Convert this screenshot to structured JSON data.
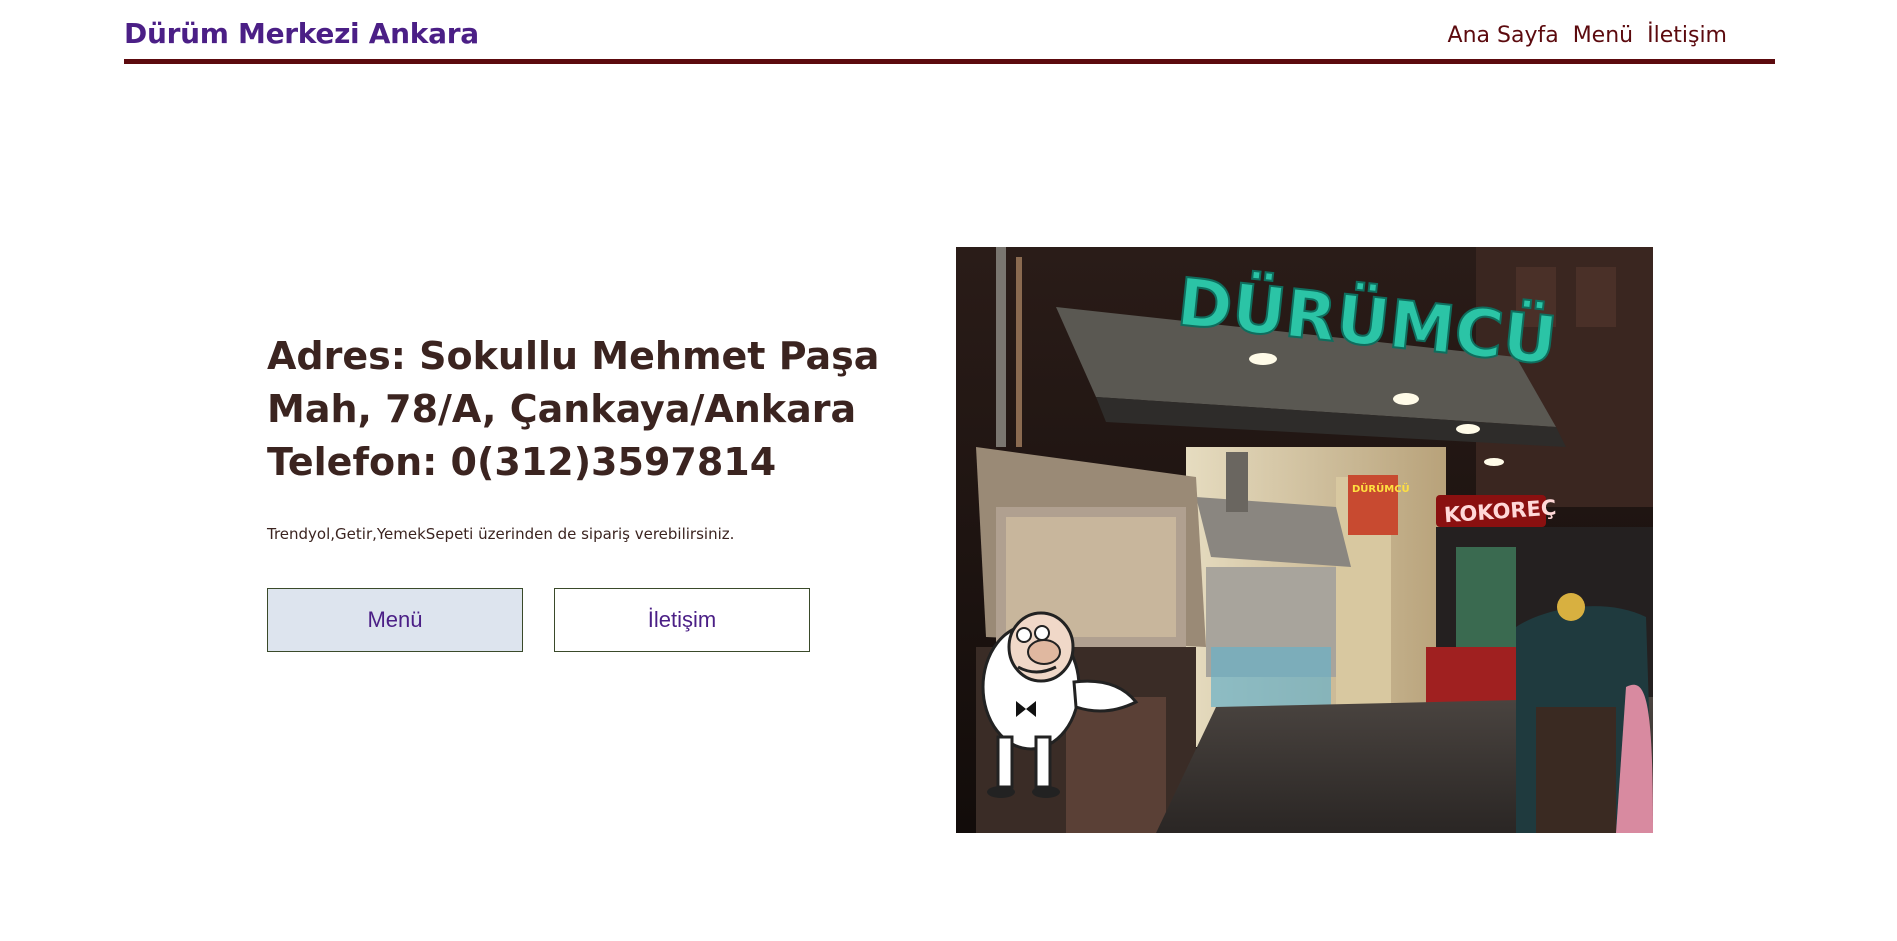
{
  "header": {
    "brand": "Dürüm Merkezi Ankara",
    "nav": [
      "Ana Sayfa",
      "Menü",
      "İletişim"
    ]
  },
  "info": {
    "address_lines": [
      "Adres: Sokullu Mehmet Paşa",
      "Mah, 78/A, Çankaya/Ankara",
      "Telefon: 0(312)3597814"
    ],
    "note": "Trendyol,Getir,YemekSepeti üzerinden de sipariş verebilirsiniz."
  },
  "buttons": {
    "menu": "Menü",
    "contact": "İletişim"
  },
  "photo": {
    "sign": "DÜRÜMCÜ",
    "side_sign": "KOKOREÇ",
    "window_sign": "DÜRÜMCÜ"
  },
  "colors": {
    "brand": "#4b1f86",
    "header_rule": "#5c0a0e",
    "text": "#3b2420",
    "menu_button_bg": "#dde4ee"
  }
}
